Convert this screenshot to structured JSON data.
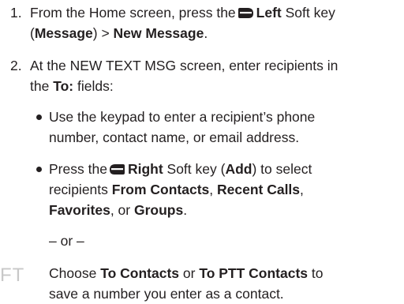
{
  "step1": {
    "number": "1.",
    "line1_pre": "From the Home screen, press the",
    "left_key": "Left",
    "line1_post": "Soft key",
    "line2_open": "(",
    "message": "Message",
    "line2_mid": ") > ",
    "new_message": "New Message",
    "line2_end": "."
  },
  "step2": {
    "number": "2.",
    "line1": "At the NEW TEXT MSG screen, enter recipients in",
    "line2_pre": "the ",
    "to_field": "To:",
    "line2_post": " fields:"
  },
  "bullet1": {
    "line1": "Use the keypad to enter a recipient’s phone",
    "line2": "number, contact name, or email address."
  },
  "bullet2": {
    "line1_pre": "Press the",
    "right_key": "Right",
    "line1_mid": " Soft key (",
    "add": "Add",
    "line1_post": ") to select",
    "line2_pre": "recipients ",
    "from_contacts": "From Contacts",
    "line2_mid": ", ",
    "recent_calls": "Recent Calls",
    "line2_post": ",",
    "favorites": "Favorites",
    "line3_mid": ", or ",
    "groups": "Groups",
    "line3_end": "."
  },
  "or_text": "– or –",
  "side_fragment": "FT",
  "choose": {
    "line1_pre": "Choose ",
    "to_contacts": "To Contacts",
    "line1_mid": " or ",
    "to_ptt_contacts": "To PTT Contacts",
    "line1_post": " to",
    "line2": "save a number you enter as a contact."
  },
  "icons": {
    "left_softkey": "left-softkey-icon",
    "right_softkey": "right-softkey-icon"
  },
  "colors": {
    "text": "#231f20",
    "faded_fragment": "#c8c8c8"
  }
}
